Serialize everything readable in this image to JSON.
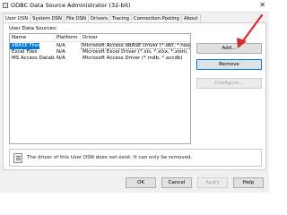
{
  "window": {
    "title": "ODBC Data Source Administrator (32-bit)",
    "close_glyph": "✕"
  },
  "tabs": [
    {
      "label": "User DSN"
    },
    {
      "label": "System DSN"
    },
    {
      "label": "File DSN"
    },
    {
      "label": "Drivers"
    },
    {
      "label": "Tracing"
    },
    {
      "label": "Connection Pooling"
    },
    {
      "label": "About"
    }
  ],
  "panel": {
    "group_label": "User Data Sources:",
    "columns": [
      "Name",
      "Platform",
      "Driver"
    ],
    "rows": [
      {
        "name": "dBASE Files",
        "platform": "N/A",
        "driver": "Microsoft Access dBASE Driver (*.dbf, *.ndx, *.mdx)",
        "selected": true
      },
      {
        "name": "Excel Files",
        "platform": "N/A",
        "driver": "Microsoft Excel Driver (*.xls, *.xlsx, *.xlsm, *.xlsb)"
      },
      {
        "name": "MS Access Database",
        "platform": "N/A",
        "driver": "Microsoft Access Driver (*.mdb, *.accdb)"
      }
    ],
    "buttons": {
      "add": "Add...",
      "remove": "Remove",
      "configure": "Configure..."
    },
    "info_text": "The driver of this User DSN does not exist. It can only be removed."
  },
  "footer": {
    "ok": "OK",
    "cancel": "Cancel",
    "apply": "Apply",
    "help": "Help"
  },
  "annotation": {
    "arrow_color": "#d9292b"
  }
}
